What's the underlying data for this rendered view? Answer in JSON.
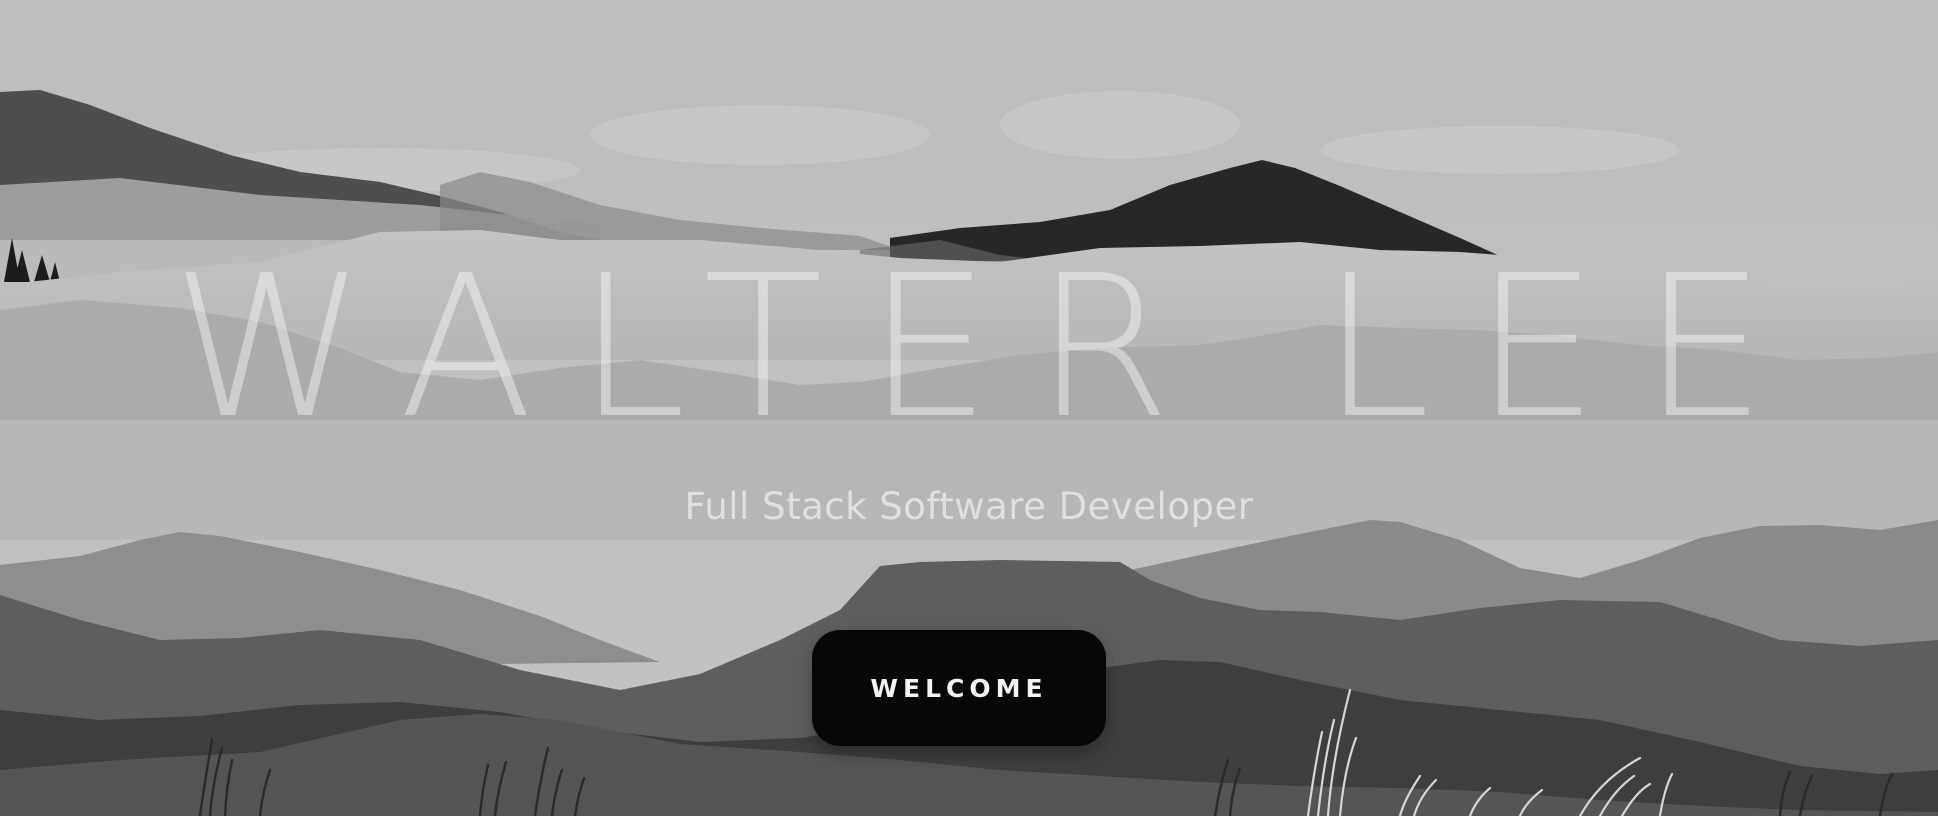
{
  "hero": {
    "name": "WALTER LEE",
    "tagline": "Full Stack Software Developer",
    "cta_label": "WELCOME"
  }
}
